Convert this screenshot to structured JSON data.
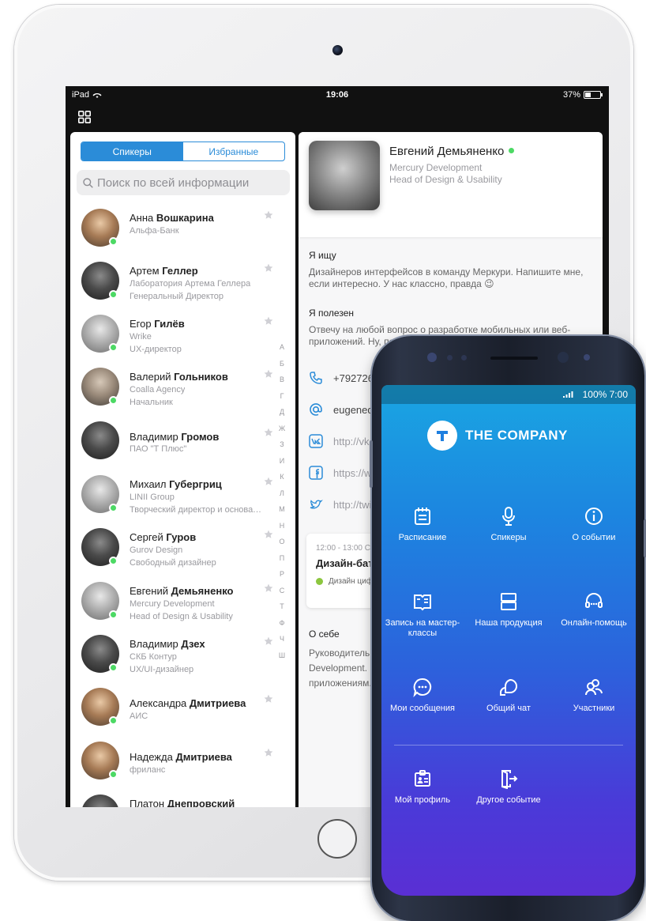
{
  "ipad": {
    "status": {
      "carrier": "iPad",
      "time": "19:06",
      "battery": "37%",
      "battery_level": 0.37
    },
    "tabs": [
      {
        "label": "Спикеры",
        "active": true
      },
      {
        "label": "Избранные",
        "active": false
      }
    ],
    "search": {
      "placeholder": "Поиск по всей информации"
    },
    "people": [
      {
        "first": "Анна",
        "last": "Вошкарина",
        "company": "Альфа-Банк",
        "role": "",
        "online": true
      },
      {
        "first": "Артем",
        "last": "Геллер",
        "company": "Лаборатория Артема Геллера",
        "role": "Генеральный Директор",
        "online": true
      },
      {
        "first": "Егор",
        "last": "Гилёв",
        "company": "Wrike",
        "role": "UX-директор",
        "online": true
      },
      {
        "first": "Валерий",
        "last": "Гольников",
        "company": "Coalla Agency",
        "role": "Начальник",
        "online": true
      },
      {
        "first": "Владимир",
        "last": "Громов",
        "company": "ПАО \"Т Плюс\"",
        "role": "",
        "online": false
      },
      {
        "first": "Михаил",
        "last": "Губергриц",
        "company": "LINII Group",
        "role": "Творческий директор и основатель",
        "online": true
      },
      {
        "first": "Сергей",
        "last": "Гуров",
        "company": "Gurov Design",
        "role": "Свободный дизайнер",
        "online": true
      },
      {
        "first": "Евгений",
        "last": "Демьяненко",
        "company": "Mercury Development",
        "role": "Head of Design & Usability",
        "online": true
      },
      {
        "first": "Владимир",
        "last": "Дзех",
        "company": "СКБ Контур",
        "role": "UX/UI-дизайнер",
        "online": true
      },
      {
        "first": "Александра",
        "last": "Дмитриева",
        "company": "АИС",
        "role": "",
        "online": true
      },
      {
        "first": "Надежда",
        "last": "Дмитриева",
        "company": "фриланс",
        "role": "",
        "online": true
      },
      {
        "first": "Платон",
        "last": "Днепровский",
        "company": "",
        "role": "",
        "online": false
      }
    ],
    "alphabet": [
      "А",
      "Б",
      "В",
      "Г",
      "Д",
      "Ж",
      "З",
      "И",
      "К",
      "Л",
      "М",
      "Н",
      "О",
      "П",
      "Р",
      "С",
      "Т",
      "Ф",
      "Ч",
      "Ш"
    ],
    "profile": {
      "name": "Евгений Демьяненко",
      "company": "Mercury Development",
      "role": "Head of Design & Usability",
      "looking_title": "Я ищу",
      "looking_text": "Дизайнеров интерфейсов в команду Меркури. Напишите мне, если интересно. У нас классно, правда 😉",
      "useful_title": "Я полезен",
      "useful_text": "Отвечу на любой вопрос о разработке мобильных или веб-приложений. Ну, почти любой 😊",
      "contacts": [
        {
          "icon": "phone-icon",
          "value": "+79272618"
        },
        {
          "icon": "at-icon",
          "value": "eugeneder"
        },
        {
          "icon": "vk-icon",
          "value": "http://vk.c"
        },
        {
          "icon": "facebook-icon",
          "value": "https://ww"
        },
        {
          "icon": "twitter-icon",
          "value": "http://twit"
        }
      ],
      "event": {
        "time": "12:00 - 13:00 Суб",
        "title": "Дизайн-батл:",
        "tag": "Дизайн циф"
      },
      "about_title": "О себе",
      "about_text": "Руководитель от Development. Эк приложениям. О"
    }
  },
  "phone": {
    "status": "↯.⩠ 100% ■ 7:00",
    "status_text": "100% 7:00",
    "brand": "THE COMPANY",
    "menu": [
      {
        "label": "Расписание",
        "icon": "calendar-icon"
      },
      {
        "label": "Спикеры",
        "icon": "microphone-icon"
      },
      {
        "label": "О событии",
        "icon": "info-icon"
      },
      {
        "label": "Запись на мастер-классы",
        "icon": "book-icon"
      },
      {
        "label": "Наша продукция",
        "icon": "product-icon"
      },
      {
        "label": "Онлайн-помощь",
        "icon": "headset-icon"
      },
      {
        "label": "Мои сообщения",
        "icon": "chat-icon"
      },
      {
        "label": "Общий чат",
        "icon": "group-chat-icon"
      },
      {
        "label": "Участники",
        "icon": "people-icon"
      },
      {
        "label": "Мой профиль",
        "icon": "profile-icon"
      },
      {
        "label": "Другое событие",
        "icon": "exit-icon"
      }
    ]
  },
  "colors": {
    "accent": "#2b8cd8",
    "online": "#4cd964",
    "event_tag": "#8cc63f"
  }
}
